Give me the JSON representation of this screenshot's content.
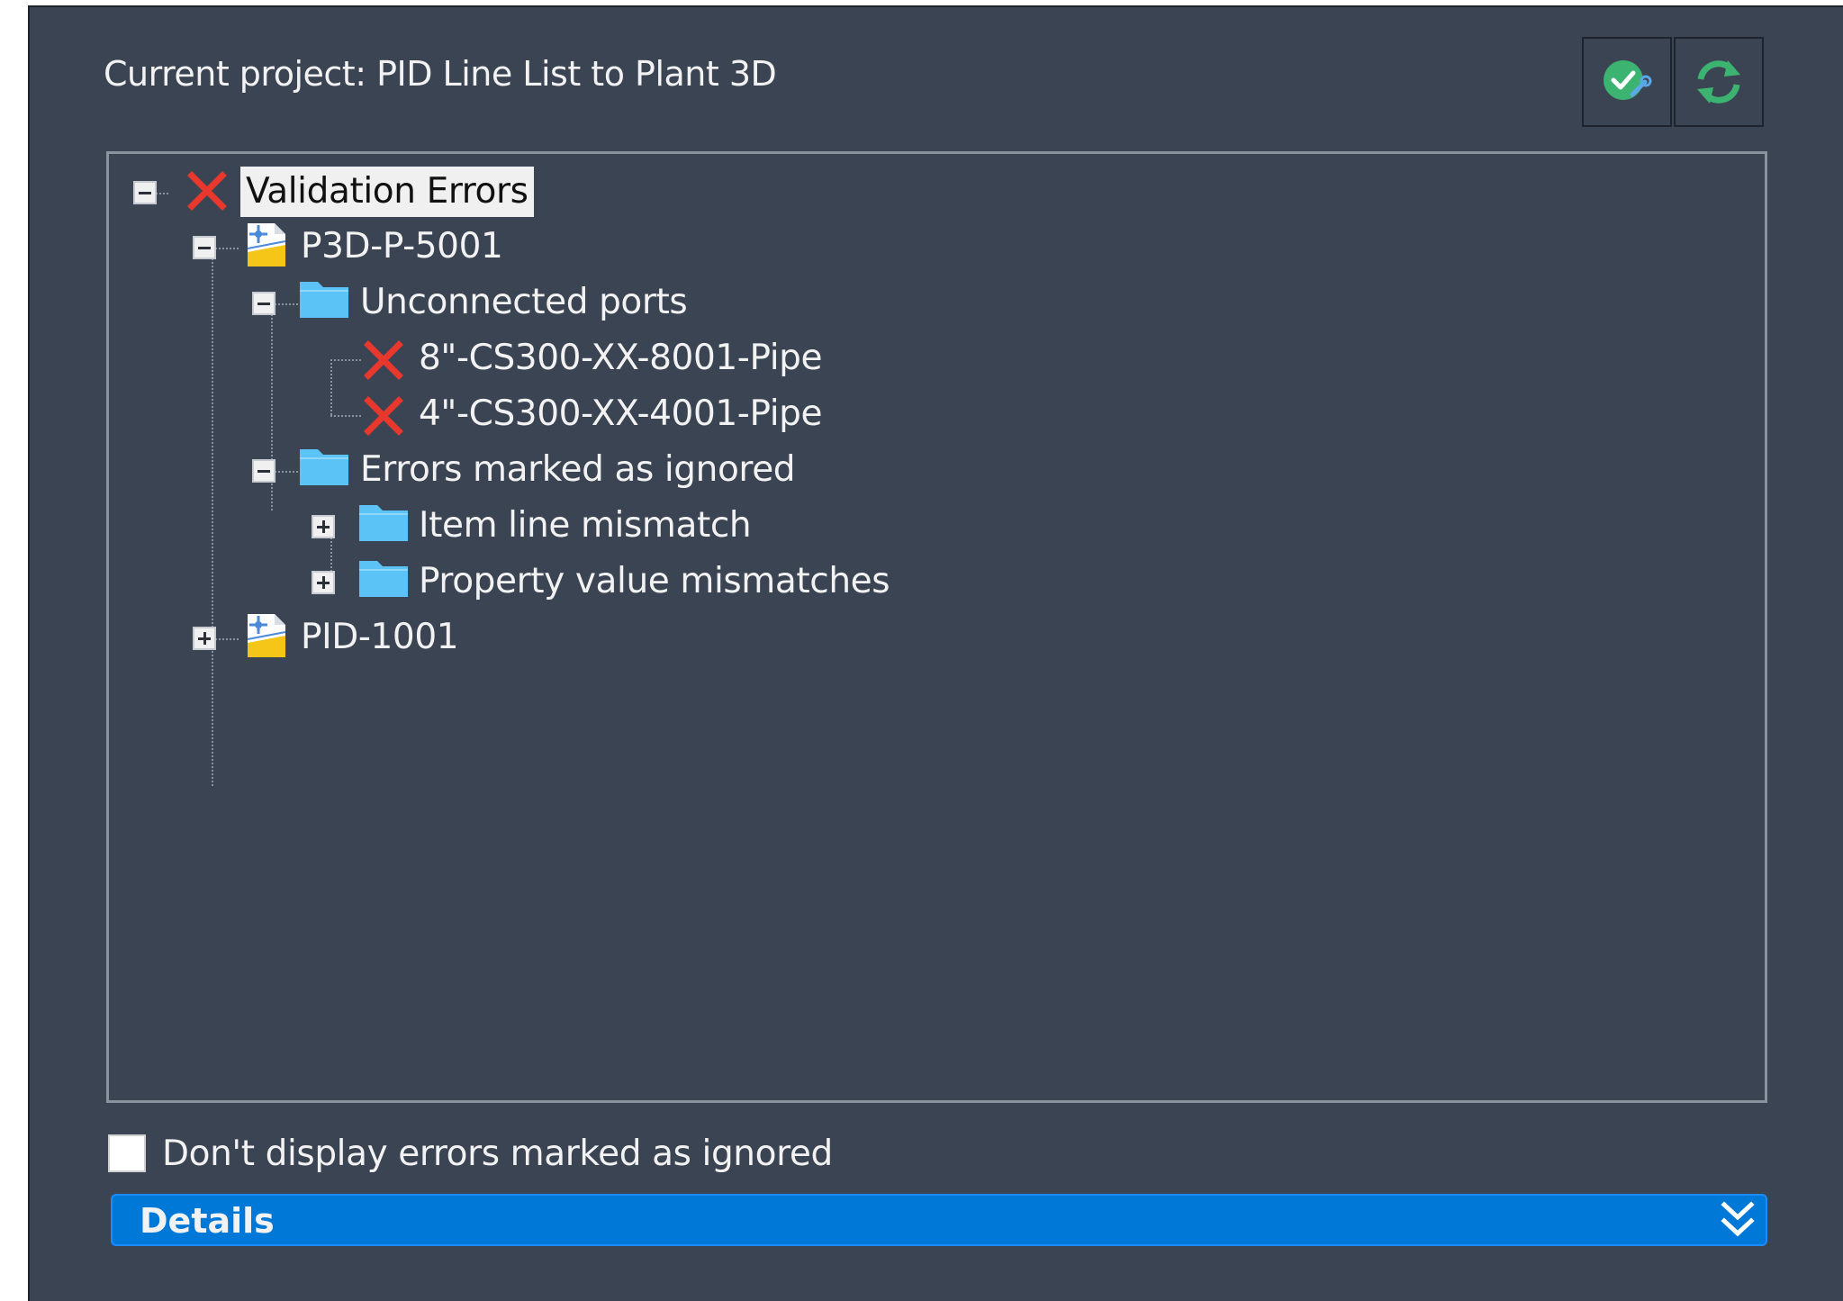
{
  "header": {
    "project_label": "Current project: PID Line List to Plant 3D",
    "validate_button_icon": "validate-check-icon",
    "refresh_button_icon": "refresh-icon"
  },
  "tree": {
    "root": {
      "label": "Validation Errors",
      "icon": "error-x-icon",
      "expanded": true,
      "selected": true
    },
    "drawing_1": {
      "label": "P3D-P-5001",
      "icon": "drawing-icon",
      "expanded": true
    },
    "unconnected_ports": {
      "label": "Unconnected ports",
      "icon": "folder-icon",
      "expanded": true
    },
    "error_1": {
      "label": "8\"-CS300-XX-8001-Pipe",
      "icon": "error-x-icon"
    },
    "error_2": {
      "label": "4\"-CS300-XX-4001-Pipe",
      "icon": "error-x-icon"
    },
    "ignored": {
      "label": "Errors marked as ignored",
      "icon": "folder-icon",
      "expanded": true
    },
    "item_line_mismatch": {
      "label": "Item line mismatch",
      "icon": "folder-icon",
      "expanded": false
    },
    "property_mismatches": {
      "label": "Property value mismatches",
      "icon": "folder-icon",
      "expanded": false
    },
    "drawing_2": {
      "label": "PID-1001",
      "icon": "drawing-icon",
      "expanded": false
    }
  },
  "options": {
    "hide_ignored_label": "Don't display errors marked as ignored",
    "hide_ignored_checked": false
  },
  "details": {
    "label": "Details",
    "icon": "double-chevron-down-icon"
  },
  "colors": {
    "panel_bg": "#3b4453",
    "accent": "#0078d7",
    "error_red": "#e8372c",
    "folder_blue": "#5bc3f5",
    "text": "#f2f2f2"
  }
}
